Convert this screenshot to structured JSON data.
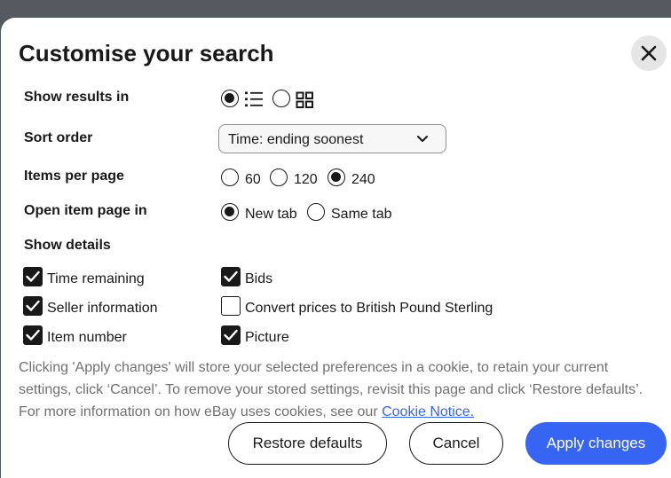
{
  "dialog": {
    "title": "Customise your search",
    "close_icon": "close-icon"
  },
  "show_results_in": {
    "label": "Show results in",
    "options": [
      {
        "icon": "list-view-icon",
        "selected": true
      },
      {
        "icon": "grid-view-icon",
        "selected": false
      }
    ]
  },
  "sort_order": {
    "label": "Sort order",
    "value": "Time: ending soonest",
    "icon": "chevron-down-icon"
  },
  "items_per_page": {
    "label": "Items per page",
    "options": [
      {
        "label": "60",
        "selected": false
      },
      {
        "label": "120",
        "selected": false
      },
      {
        "label": "240",
        "selected": true
      }
    ]
  },
  "open_item_page_in": {
    "label": "Open item page in",
    "options": [
      {
        "label": "New tab",
        "selected": true
      },
      {
        "label": "Same tab",
        "selected": false
      }
    ]
  },
  "show_details": {
    "label": "Show details",
    "options": [
      {
        "label": "Time remaining",
        "checked": true
      },
      {
        "label": "Bids",
        "checked": true
      },
      {
        "label": "Seller information",
        "checked": true
      },
      {
        "label": "Convert prices to British Pound Sterling",
        "checked": false
      },
      {
        "label": "Item number",
        "checked": true
      },
      {
        "label": "Picture",
        "checked": true
      }
    ]
  },
  "cookie_notice": {
    "text": "Clicking 'Apply changes' will store your selected preferences in a cookie, to retain your current settings, click ‘Cancel’. To remove your stored settings, revisit this page and click ‘Restore defaults’. For more information on how eBay uses cookies, see our",
    "link_text": "Cookie Notice."
  },
  "buttons": {
    "restore": "Restore defaults",
    "cancel": "Cancel",
    "apply": "Apply changes"
  },
  "colors": {
    "primary": "#3665f3",
    "text": "#191919",
    "muted_text": "#707070",
    "backdrop": "#545a60"
  }
}
